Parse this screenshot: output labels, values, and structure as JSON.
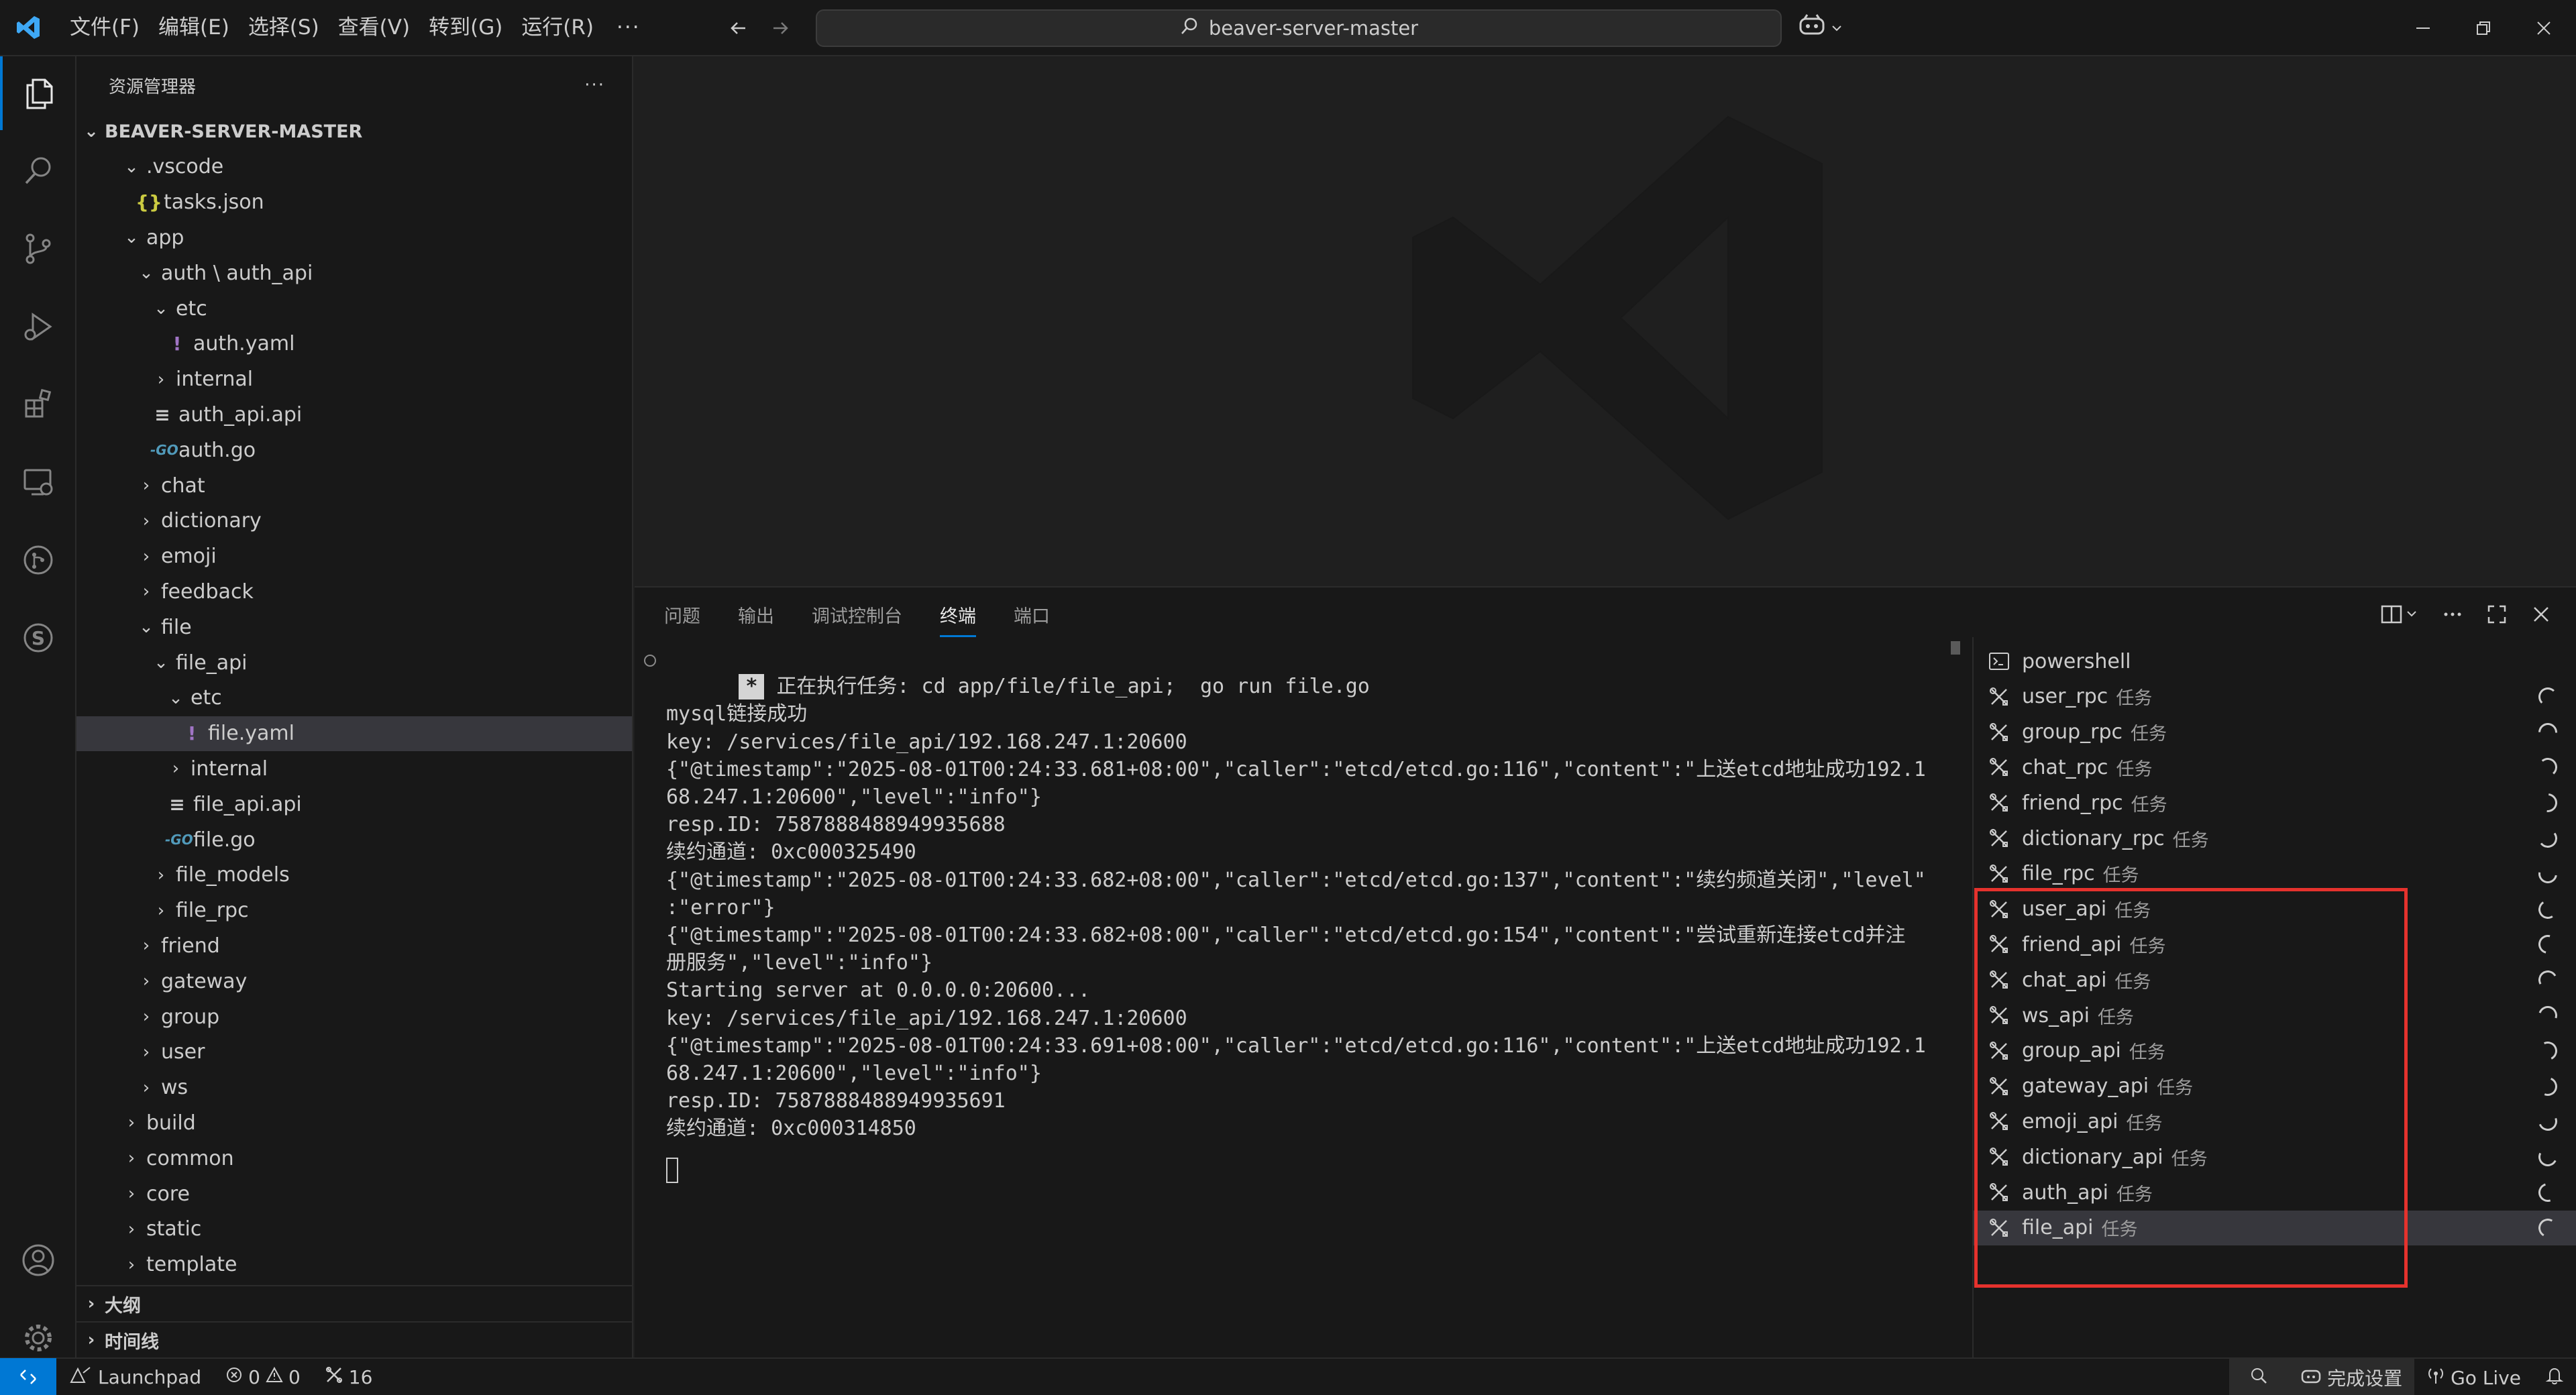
{
  "titlebar": {
    "menus": [
      "文件(F)",
      "编辑(E)",
      "选择(S)",
      "查看(V)",
      "转到(G)",
      "运行(R)"
    ],
    "more": "···",
    "search_text": "beaver-server-master"
  },
  "activitybar": {
    "items": [
      "explorer",
      "search",
      "source-control",
      "run-debug",
      "extensions",
      "remote-explorer",
      "gitlens",
      "sqltools"
    ],
    "bottom": [
      "accounts",
      "settings"
    ]
  },
  "sidebar": {
    "title": "资源管理器",
    "more": "···",
    "root": "BEAVER-SERVER-MASTER",
    "tree": [
      {
        "label": ".vscode",
        "depth": 1,
        "type": "folder-open"
      },
      {
        "label": "tasks.json",
        "depth": 2,
        "type": "json",
        "icon": "{}"
      },
      {
        "label": "app",
        "depth": 1,
        "type": "folder-open"
      },
      {
        "label": "auth \\ auth_api",
        "depth": 2,
        "type": "folder-open"
      },
      {
        "label": "etc",
        "depth": 3,
        "type": "folder-open"
      },
      {
        "label": "auth.yaml",
        "depth": 4,
        "type": "yaml",
        "icon": "!"
      },
      {
        "label": "internal",
        "depth": 3,
        "type": "folder"
      },
      {
        "label": "auth_api.api",
        "depth": 3,
        "type": "api",
        "icon": "≡"
      },
      {
        "label": "auth.go",
        "depth": 3,
        "type": "go",
        "icon": "-GO"
      },
      {
        "label": "chat",
        "depth": 2,
        "type": "folder"
      },
      {
        "label": "dictionary",
        "depth": 2,
        "type": "folder"
      },
      {
        "label": "emoji",
        "depth": 2,
        "type": "folder"
      },
      {
        "label": "feedback",
        "depth": 2,
        "type": "folder"
      },
      {
        "label": "file",
        "depth": 2,
        "type": "folder-open"
      },
      {
        "label": "file_api",
        "depth": 3,
        "type": "folder-open"
      },
      {
        "label": "etc",
        "depth": 4,
        "type": "folder-open"
      },
      {
        "label": "file.yaml",
        "depth": 5,
        "type": "yaml",
        "icon": "!",
        "selected": true
      },
      {
        "label": "internal",
        "depth": 4,
        "type": "folder"
      },
      {
        "label": "file_api.api",
        "depth": 4,
        "type": "api",
        "icon": "≡"
      },
      {
        "label": "file.go",
        "depth": 4,
        "type": "go",
        "icon": "-GO"
      },
      {
        "label": "file_models",
        "depth": 3,
        "type": "folder"
      },
      {
        "label": "file_rpc",
        "depth": 3,
        "type": "folder"
      },
      {
        "label": "friend",
        "depth": 2,
        "type": "folder"
      },
      {
        "label": "gateway",
        "depth": 2,
        "type": "folder"
      },
      {
        "label": "group",
        "depth": 2,
        "type": "folder"
      },
      {
        "label": "user",
        "depth": 2,
        "type": "folder"
      },
      {
        "label": "ws",
        "depth": 2,
        "type": "folder"
      },
      {
        "label": "build",
        "depth": 1,
        "type": "folder"
      },
      {
        "label": "common",
        "depth": 1,
        "type": "folder"
      },
      {
        "label": "core",
        "depth": 1,
        "type": "folder"
      },
      {
        "label": "static",
        "depth": 1,
        "type": "folder"
      },
      {
        "label": "template",
        "depth": 1,
        "type": "folder"
      }
    ],
    "sections": [
      "大纲",
      "时间线"
    ]
  },
  "panel": {
    "tabs": [
      "问题",
      "输出",
      "调试控制台",
      "终端",
      "端口"
    ],
    "active_tab": "终端",
    "terminal": {
      "task_badge": "*",
      "task_line": "正在执行任务: cd app/file/file_api;  go run file.go",
      "lines": [
        "",
        "mysql链接成功",
        "key: /services/file_api/192.168.247.1:20600",
        "{\"@timestamp\":\"2025-08-01T00:24:33.681+08:00\",\"caller\":\"etcd/etcd.go:116\",\"content\":\"上送etcd地址成功192.1",
        "68.247.1:20600\",\"level\":\"info\"}",
        "resp.ID: 7587888488949935688",
        "续约通道: 0xc000325490",
        "{\"@timestamp\":\"2025-08-01T00:24:33.682+08:00\",\"caller\":\"etcd/etcd.go:137\",\"content\":\"续约频道关闭\",\"level\"",
        ":\"error\"}",
        "{\"@timestamp\":\"2025-08-01T00:24:33.682+08:00\",\"caller\":\"etcd/etcd.go:154\",\"content\":\"尝试重新连接etcd并注",
        "册服务\",\"level\":\"info\"}",
        "Starting server at 0.0.0.0:20600...",
        "key: /services/file_api/192.168.247.1:20600",
        "{\"@timestamp\":\"2025-08-01T00:24:33.691+08:00\",\"caller\":\"etcd/etcd.go:116\",\"content\":\"上送etcd地址成功192.1",
        "68.247.1:20600\",\"level\":\"info\"}",
        "resp.ID: 7587888488949935691",
        "续约通道: 0xc000314850"
      ]
    },
    "tasks": {
      "shell": "powershell",
      "suffix": "任务",
      "items": [
        "user_rpc",
        "group_rpc",
        "chat_rpc",
        "friend_rpc",
        "dictionary_rpc",
        "file_rpc",
        "user_api",
        "friend_api",
        "chat_api",
        "ws_api",
        "group_api",
        "gateway_api",
        "emoji_api",
        "dictionary_api",
        "auth_api",
        "file_api"
      ],
      "selected": "file_api"
    }
  },
  "statusbar": {
    "launchpad": "Launchpad",
    "errors": "0",
    "warnings": "0",
    "ports": "16",
    "setup": "完成设置",
    "golive": "Go Live"
  },
  "colors": {
    "accent": "#0078d4",
    "highlight_box": "#e5322d",
    "yaml_icon": "#a074c4",
    "go_icon": "#519aba",
    "json_icon": "#cbcb41"
  }
}
